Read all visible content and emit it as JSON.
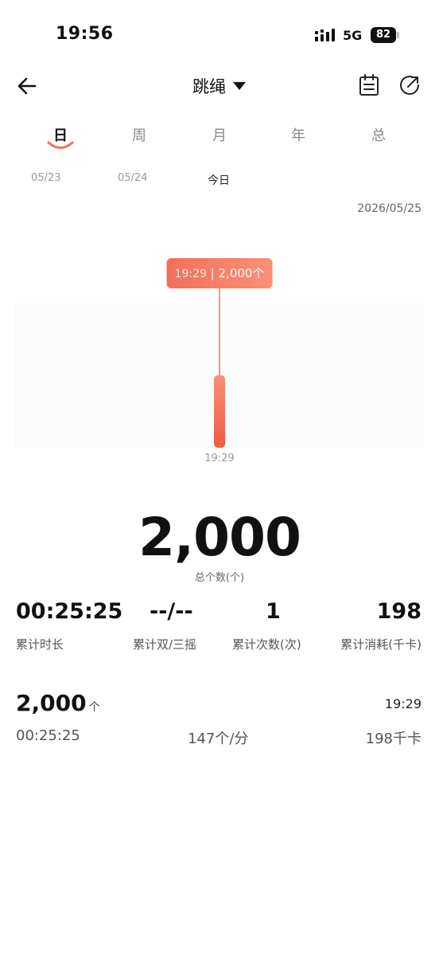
{
  "status_bar": {
    "time": "19:56",
    "network": "5G",
    "battery": "82"
  },
  "header": {
    "title": "跳绳",
    "icons": [
      "back-arrow-icon",
      "dropdown-triangle-icon",
      "calendar-icon",
      "share-icon"
    ]
  },
  "tabs": [
    {
      "label": "日",
      "active": true
    },
    {
      "label": "周",
      "active": false
    },
    {
      "label": "月",
      "active": false
    },
    {
      "label": "年",
      "active": false
    },
    {
      "label": "总",
      "active": false
    }
  ],
  "dates": [
    "05/23",
    "05/24",
    "今日"
  ],
  "current_date": "2026/05/25",
  "colors": {
    "accent": "#f2705a",
    "bar_top": "#fb8f78",
    "bar_bottom": "#f25a44"
  },
  "chart_data": {
    "type": "bar",
    "categories": [
      "19:29"
    ],
    "values": [
      2000
    ],
    "tooltip": {
      "time": "19:29",
      "value": "2,000个"
    },
    "x_tick_labels": [
      "19:29"
    ],
    "ylim": [
      0,
      4000
    ]
  },
  "summary": {
    "total_value": "2,000",
    "total_label": "总个数(个)",
    "stats": [
      {
        "value": "00:25:25",
        "label": "累计时长"
      },
      {
        "value": "--/--",
        "label": "累计双/三摇"
      },
      {
        "value": "1",
        "label": "累计次数(次)"
      },
      {
        "value": "198",
        "label": "累计消耗(千卡)"
      }
    ]
  },
  "record": {
    "count": "2,000",
    "unit": "个",
    "time": "19:29",
    "duration": "00:25:25",
    "rate": "147个/分",
    "calories": "198千卡"
  }
}
